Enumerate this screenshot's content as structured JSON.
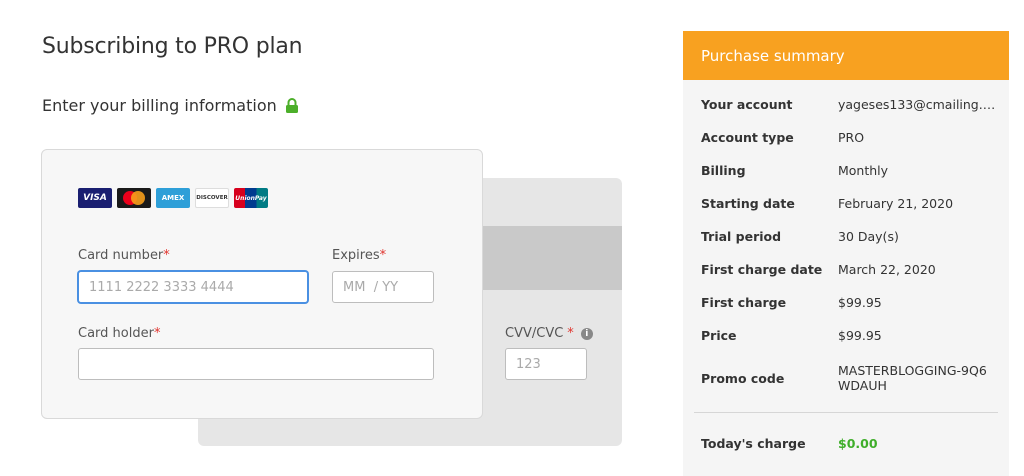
{
  "page": {
    "title": "Subscribing to PRO plan",
    "billing_heading": "Enter your billing information"
  },
  "card": {
    "logos": [
      {
        "name": "visa",
        "label": "VISA"
      },
      {
        "name": "mastercard",
        "label": ""
      },
      {
        "name": "amex",
        "label": "AMEX"
      },
      {
        "name": "discover",
        "label": "DISCOVER"
      },
      {
        "name": "unionpay",
        "label": "UnionPay"
      }
    ],
    "card_number_label": "Card number",
    "card_number_placeholder": "1111 2222 3333 4444",
    "card_number_value": "",
    "expires_label": "Expires",
    "expires_placeholder": "MM  / YY",
    "expires_value": "",
    "card_holder_label": "Card holder",
    "card_holder_value": "",
    "cvv_label": "CVV/CVC",
    "cvv_placeholder": "123",
    "cvv_value": "",
    "required_mark": "*"
  },
  "summary": {
    "header": "Purchase summary",
    "rows": [
      {
        "key": "Your account",
        "value": "yageses133@cmailing.c…"
      },
      {
        "key": "Account type",
        "value": "PRO"
      },
      {
        "key": "Billing",
        "value": "Monthly"
      },
      {
        "key": "Starting date",
        "value": "February 21, 2020"
      },
      {
        "key": "Trial period",
        "value": "30 Day(s)"
      },
      {
        "key": "First charge date",
        "value": "March 22, 2020"
      },
      {
        "key": "First charge",
        "value": "$99.95"
      },
      {
        "key": "Price",
        "value": "$99.95"
      },
      {
        "key": "Promo code",
        "value": "MASTERBLOGGING-9Q6WDAUH"
      }
    ],
    "today_label": "Today's charge",
    "today_value": "$0.00"
  },
  "colors": {
    "accent_orange": "#f8a120",
    "success_green": "#3fae2a",
    "required_red": "#e0332d",
    "focus_blue": "#4a90e2",
    "lock_green": "#4caf2a"
  },
  "icons": {
    "lock": "lock-icon",
    "info": "info-icon"
  }
}
